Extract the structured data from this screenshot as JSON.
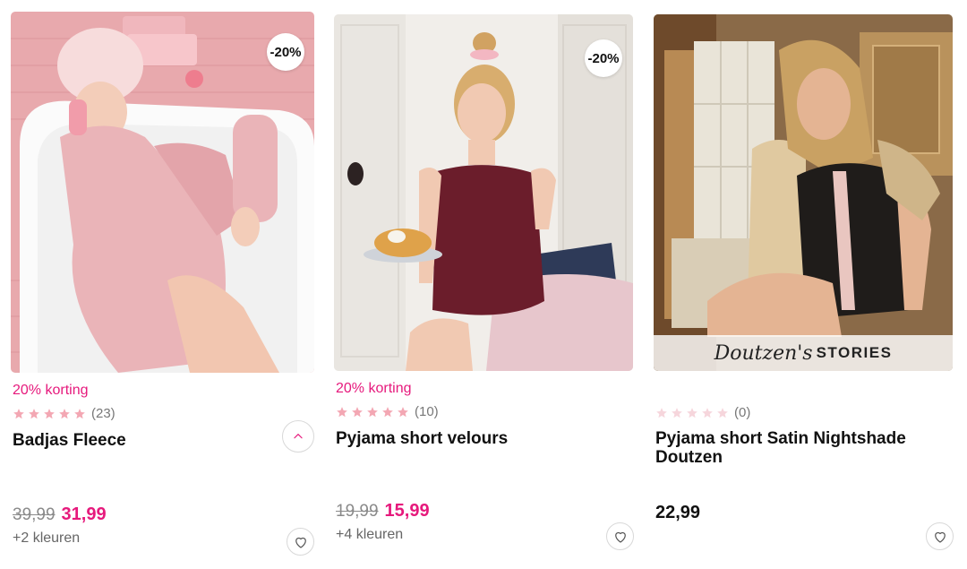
{
  "products": [
    {
      "discount_badge": "-20%",
      "promo": "20% korting",
      "rating_stars": 5,
      "rating_count": "(23)",
      "name": "Badjas Fleece",
      "old_price": "39,99",
      "new_price": "31,99",
      "colors_note": "+2 kleuren"
    },
    {
      "discount_badge": "-20%",
      "promo": "20% korting",
      "rating_stars": 5,
      "rating_count": "(10)",
      "name": "Pyjama short velours",
      "old_price": "19,99",
      "new_price": "15,99",
      "colors_note": "+4 kleuren"
    },
    {
      "rating_stars": 0,
      "rating_count": "(0)",
      "name": "Pyjama short Satin Nightshade Doutzen",
      "price": "22,99",
      "banner": {
        "script": "Doutzen's",
        "word": "STORIES"
      }
    }
  ],
  "icons": {
    "star": "star-icon",
    "heart": "heart-icon",
    "chevron": "chevron-up-icon"
  },
  "colors": {
    "accent": "#e6197c",
    "star_filled": "#f3a7b3",
    "star_empty": "#f6d6dc"
  }
}
